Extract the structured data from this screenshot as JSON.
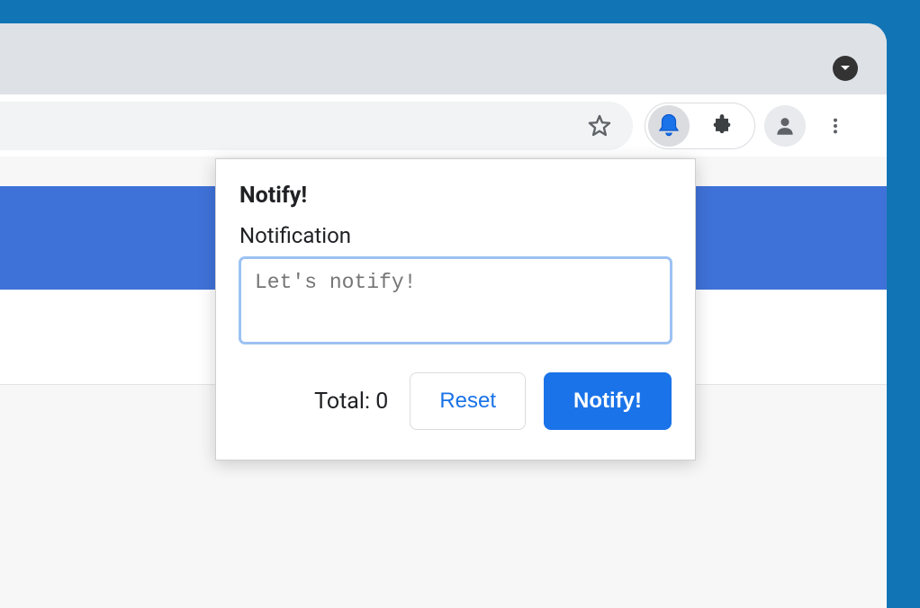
{
  "popup": {
    "title": "Notify!",
    "field_label": "Notification",
    "placeholder": "Let's notify!",
    "value": "",
    "total_label": "Total: ",
    "total_count": "0",
    "reset_label": "Reset",
    "notify_label": "Notify!"
  },
  "colors": {
    "accent": "#1a73e8",
    "band": "#3f72d8",
    "window_outer": "#1175b5"
  }
}
